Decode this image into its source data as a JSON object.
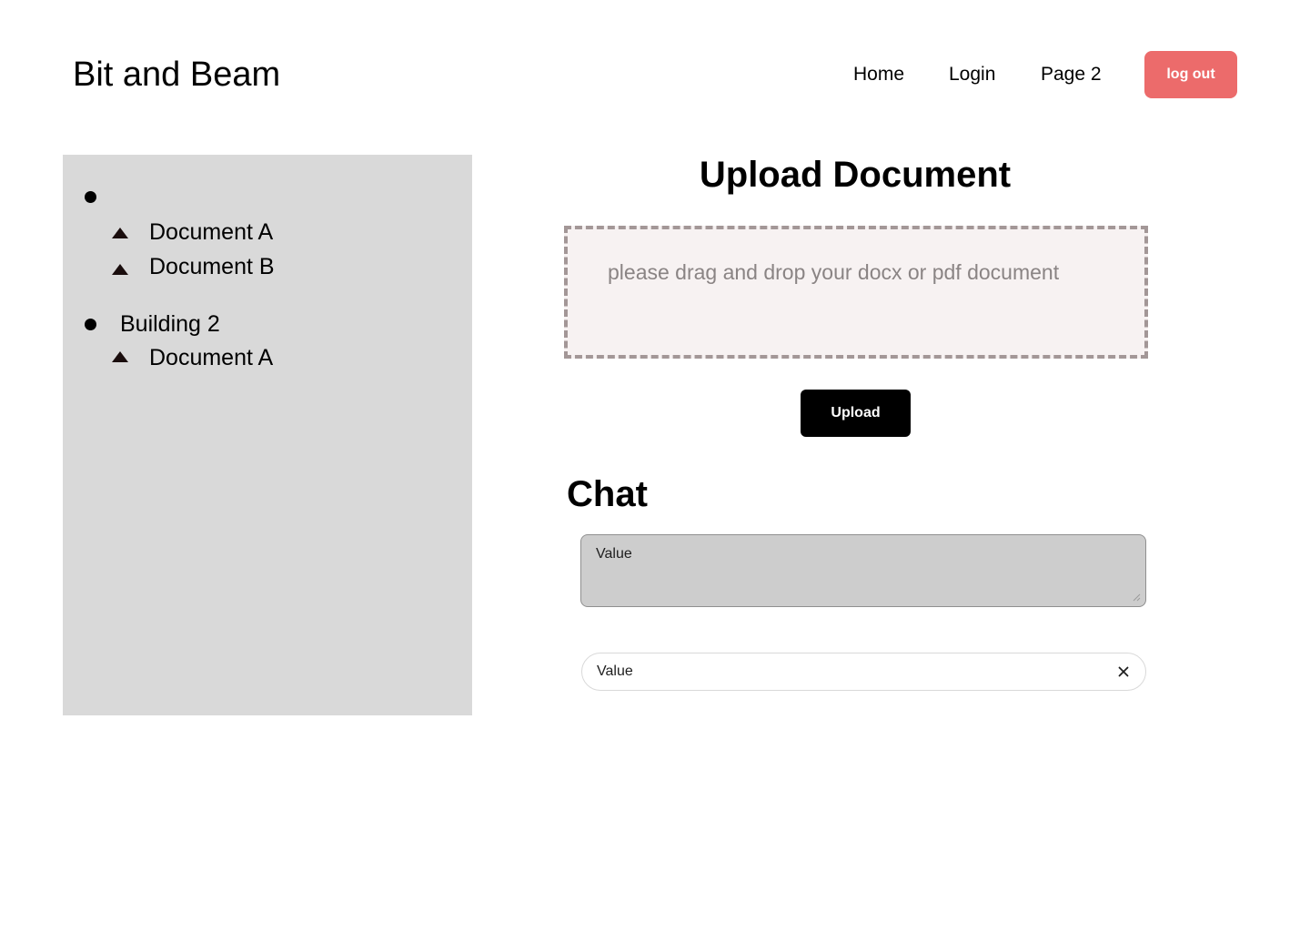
{
  "header": {
    "brand": "Bit and Beam",
    "nav": [
      {
        "label": "Home"
      },
      {
        "label": "Login"
      },
      {
        "label": "Page 2"
      }
    ],
    "logout_label": "log out"
  },
  "sidebar": {
    "buildings": [
      {
        "name": "",
        "documents": [
          "Document A",
          "Document B"
        ]
      },
      {
        "name": "Building 2",
        "documents": [
          "Document A"
        ]
      }
    ]
  },
  "upload": {
    "title": "Upload Document",
    "dropzone_text": "please drag and drop your docx or pdf document",
    "button_label": "Upload"
  },
  "chat": {
    "title": "Chat",
    "textarea_value": "Value",
    "input_value": "Value"
  },
  "icons": {
    "clear": "close-icon",
    "resize": "resize-grip-icon",
    "bullet": "circle-bullet-icon",
    "document": "triangle-icon"
  },
  "colors": {
    "accent": "#ec6b6b",
    "sidebar_bg": "#d9d9d9",
    "dropzone_bg": "#f7f2f2",
    "dropzone_border": "#a39797",
    "primary_button": "#000000"
  }
}
